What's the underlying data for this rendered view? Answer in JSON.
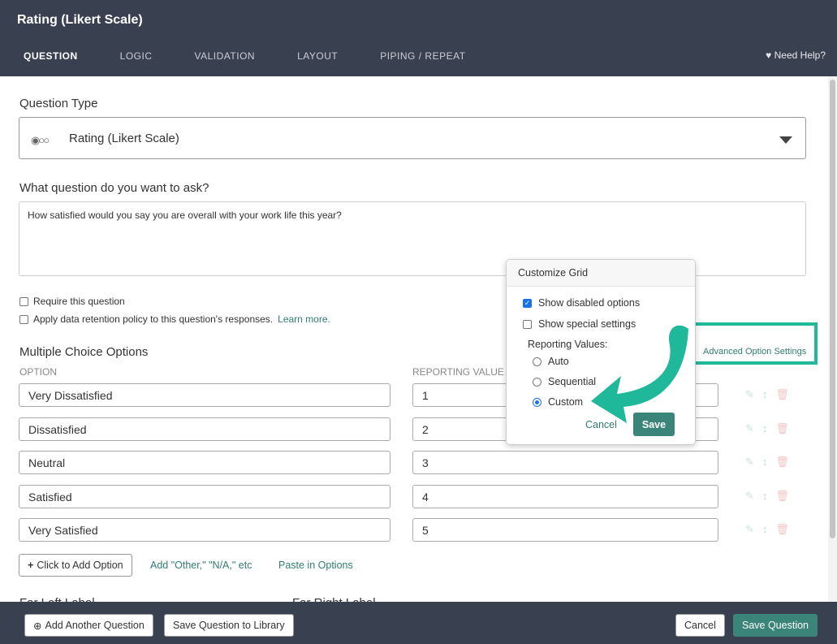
{
  "header": {
    "title": "Rating (Likert Scale)",
    "tabs": [
      {
        "label": "QUESTION",
        "active": true
      },
      {
        "label": "LOGIC"
      },
      {
        "label": "VALIDATION"
      },
      {
        "label": "LAYOUT"
      },
      {
        "label": "PIPING / REPEAT"
      }
    ],
    "help": "Need Help?",
    "help_icon": "heart-icon"
  },
  "form": {
    "question_type_label": "Question Type",
    "question_type_value": "Rating (Likert Scale)",
    "question_type_icon": "rating-circles-icon",
    "question_label": "What question do you want to ask?",
    "question_value": "How satisfied would you say you are overall with your work life this year?",
    "require": "Require this question",
    "retention": "Apply data retention policy to this question's responses.",
    "learn_more": "Learn more.",
    "mc_title": "Multiple Choice Options",
    "col_option": "OPTION",
    "col_reporting": "REPORTING VALUE",
    "options": [
      {
        "label": "Very Dissatisfied",
        "value": "1"
      },
      {
        "label": "Dissatisfied",
        "value": "2"
      },
      {
        "label": "Neutral",
        "value": "3"
      },
      {
        "label": "Satisfied",
        "value": "4"
      },
      {
        "label": "Very Satisfied",
        "value": "5"
      }
    ],
    "add_option": "Click to Add Option",
    "add_other": "Add \"Other,\" \"N/A,\" etc",
    "paste": "Paste in Options",
    "advanced": "Advanced Option Settings",
    "far_left": "Far Left Label",
    "far_right": "Far Right Label"
  },
  "popover": {
    "title": "Customize Grid",
    "show_disabled": "Show disabled options",
    "show_disabled_checked": true,
    "show_special": "Show special settings",
    "show_special_checked": false,
    "reporting_label": "Reporting Values:",
    "radios": [
      "Auto",
      "Sequential",
      "Custom"
    ],
    "selected": "Custom",
    "cancel": "Cancel",
    "save": "Save"
  },
  "footer": {
    "add_another": "Add Another Question",
    "save_library": "Save Question to Library",
    "cancel": "Cancel",
    "save_question": "Save Question"
  },
  "colors": {
    "header": "#394150",
    "accent": "#3a8479",
    "annotation": "#1fb89a"
  }
}
